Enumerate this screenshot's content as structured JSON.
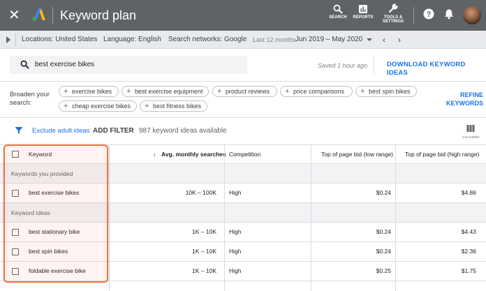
{
  "app": {
    "title": "Keyword plan",
    "close_icon": "close-icon",
    "logo_icon": "google-ads-logo"
  },
  "header_tools": [
    {
      "label": "SEARCH",
      "icon": "search-icon"
    },
    {
      "label": "REPORTS",
      "icon": "reports-icon"
    },
    {
      "label": "TOOLS &\nSETTINGS",
      "icon": "wrench-icon"
    }
  ],
  "header_icons": [
    "help-icon",
    "bell-icon",
    "avatar"
  ],
  "filterbar": {
    "locations": "Locations: United States",
    "language": "Language: English",
    "networks": "Search networks: Google",
    "period_label": "Last 12 months",
    "period_value": "Jun 2019 – May 2020"
  },
  "search": {
    "value": "best exercise bikes",
    "saved": "Saved 1 hour ago",
    "download": "DOWNLOAD KEYWORD IDEAS"
  },
  "broaden": {
    "label": "Broaden your search:",
    "chips": [
      "exercise bikes",
      "best exercise equipment",
      "product reviews",
      "price comparisons",
      "best spin bikes",
      "cheap exercise bikes",
      "best fitness bikes"
    ],
    "refine": "REFINE KEYWORDS"
  },
  "toolbar": {
    "exclude": "Exclude adult ideas",
    "add_filter": "ADD FILTER",
    "count": "987 keyword ideas available",
    "columns": "COLUMNS"
  },
  "table": {
    "headers": {
      "keyword": "Keyword",
      "searches": "Avg. monthly searches",
      "competition": "Competition",
      "bid_low": "Top of page bid (low range)",
      "bid_high": "Top of page bid (high range)"
    },
    "group_provided": "Keywords you provided",
    "group_ideas": "Keyword ideas",
    "provided": [
      {
        "keyword": "best exercise bikes",
        "searches": "10K – 100K",
        "competition": "High",
        "low": "$0.24",
        "high": "$4.86"
      }
    ],
    "ideas": [
      {
        "keyword": "best stationary bike",
        "searches": "1K – 10K",
        "competition": "High",
        "low": "$0.24",
        "high": "$4.43"
      },
      {
        "keyword": "best spin bikes",
        "searches": "1K – 10K",
        "competition": "High",
        "low": "$0.24",
        "high": "$2.36"
      },
      {
        "keyword": "foldable exercise bike",
        "searches": "1K – 10K",
        "competition": "High",
        "low": "$0.25",
        "high": "$1.75"
      }
    ]
  },
  "colors": {
    "header_bg": "#5f6368",
    "accent_blue": "#1a73e8",
    "highlight": "#e8734a"
  }
}
